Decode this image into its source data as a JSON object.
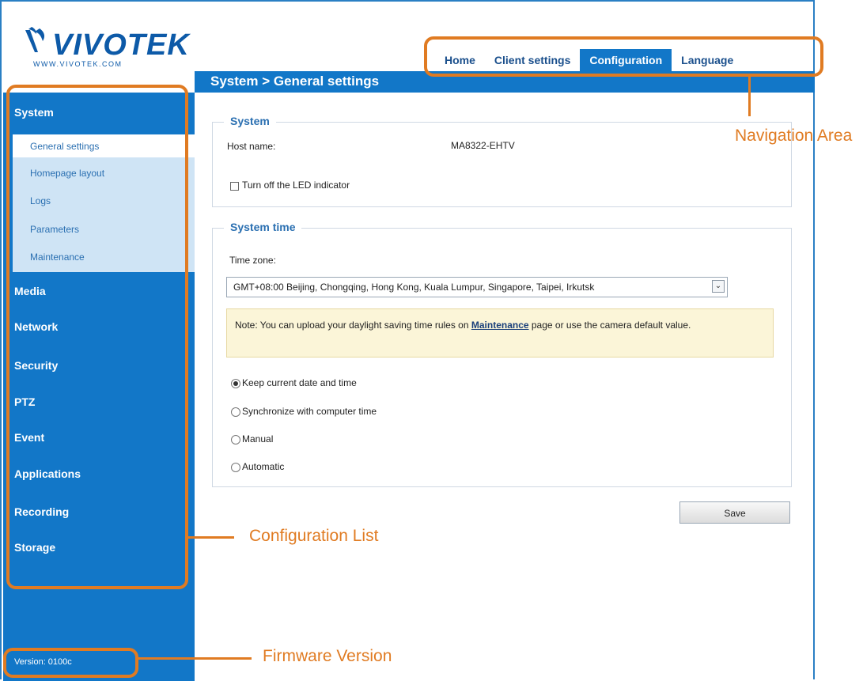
{
  "logo": {
    "wordmark": "VIVOTEK",
    "url": "WWW.VIVOTEK.COM"
  },
  "nav": {
    "items": [
      "Home",
      "Client settings",
      "Configuration",
      "Language"
    ],
    "active": "Configuration"
  },
  "breadcrumb": "System > General settings",
  "sidebar": {
    "categories": [
      "System",
      "Media",
      "Network",
      "Security",
      "PTZ",
      "Event",
      "Applications",
      "Recording",
      "Storage"
    ],
    "submenu": [
      "General settings",
      "Homepage layout",
      "Logs",
      "Parameters",
      "Maintenance"
    ],
    "active_sub": "General settings",
    "version": "Version: 0100c"
  },
  "system": {
    "legend": "System",
    "host_label": "Host name:",
    "host_value": "MA8322-EHTV",
    "led_label": "Turn off the LED indicator",
    "led_checked": false
  },
  "system_time": {
    "legend": "System time",
    "tz_label": "Time zone:",
    "tz_value": "GMT+08:00 Beijing, Chongqing, Hong Kong, Kuala Lumpur, Singapore, Taipei, Irkutsk",
    "note_prefix": "Note: You can upload your daylight saving time rules on ",
    "note_link": "Maintenance",
    "note_suffix": " page or use the camera default value.",
    "options": [
      "Keep current date and time",
      "Synchronize with computer time",
      "Manual",
      "Automatic"
    ],
    "selected": "Keep current date and time"
  },
  "save_label": "Save",
  "annotations": {
    "navigation": "Navigation Area",
    "config_list": "Configuration List",
    "firmware": "Firmware Version",
    "color": "#e07b22"
  },
  "colors": {
    "primary": "#1277c8",
    "submenu_bg": "#cfe4f5",
    "link": "#2a6fb1"
  }
}
